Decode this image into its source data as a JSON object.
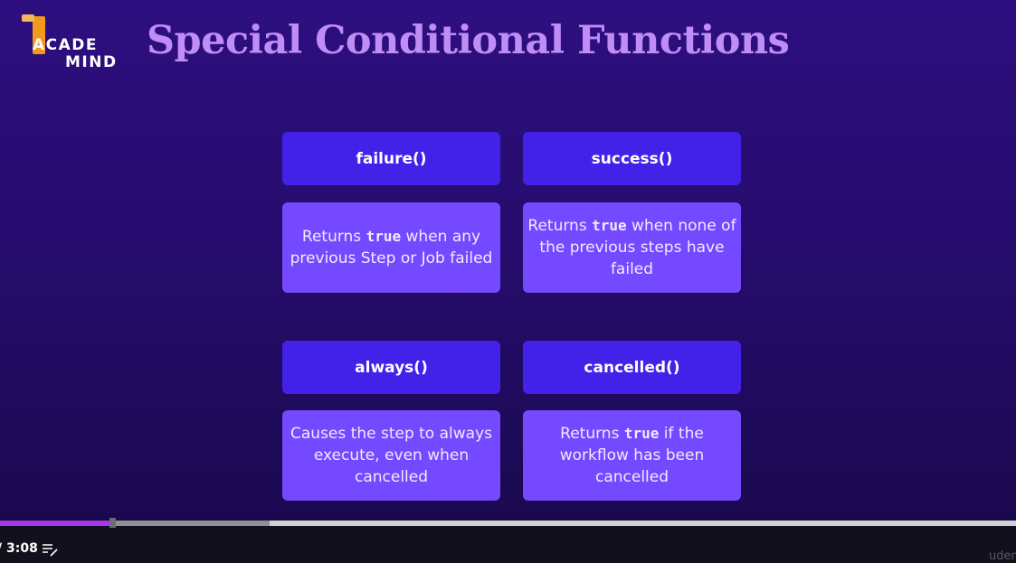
{
  "logo": {
    "line1": "ACADE",
    "line2": "MIND"
  },
  "slide": {
    "title": "Special Conditional Functions"
  },
  "cards": [
    {
      "function": "failure()",
      "desc_before": "Returns ",
      "desc_code": "true",
      "desc_after": " when any previous Step or Job failed"
    },
    {
      "function": "success()",
      "desc_before": "Returns ",
      "desc_code": "true",
      "desc_after": " when none of the previous steps have failed"
    },
    {
      "function": "always()",
      "desc_before": "Causes the step to always execute, even when cancelled",
      "desc_code": "",
      "desc_after": ""
    },
    {
      "function": "cancelled()",
      "desc_before": "Returns ",
      "desc_code": "true",
      "desc_after": " if the workflow has been cancelled"
    }
  ],
  "player": {
    "time_display": "/ 3:08",
    "played_fraction": 0.11,
    "buffered_fraction": 0.265,
    "brand_text": "udemy",
    "icons": {
      "notes": "notes-edit-icon",
      "logo": "academind-logo"
    },
    "colors": {
      "accent": "#a435f0",
      "card_head": "#4222e8",
      "card_body": "#7549ff",
      "title": "#c08cf6"
    }
  }
}
